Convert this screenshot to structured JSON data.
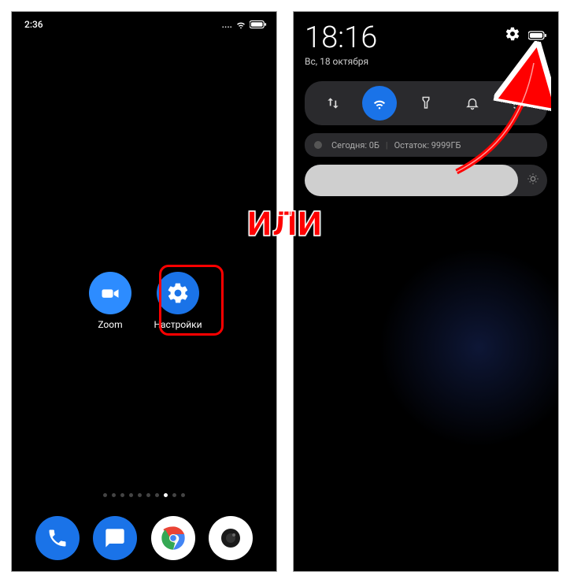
{
  "connector_label": "ИЛИ",
  "left": {
    "status_time": "2:36",
    "apps": {
      "zoom": {
        "label": "Zoom",
        "icon": "video-icon"
      },
      "settings": {
        "label": "Настройки",
        "icon": "gear-icon"
      }
    },
    "page_dots_total": 10,
    "page_dots_active_index": 7,
    "dock": [
      {
        "name": "phone",
        "icon": "phone-icon"
      },
      {
        "name": "messages",
        "icon": "chat-icon"
      },
      {
        "name": "chrome",
        "icon": "chrome-icon"
      },
      {
        "name": "camera",
        "icon": "camera-icon"
      }
    ]
  },
  "right": {
    "panel_time": "18:16",
    "panel_date": "Вс, 18 октября",
    "qs_tiles": [
      {
        "name": "mobile-data",
        "icon": "data-arrows-icon",
        "on": false
      },
      {
        "name": "wifi",
        "icon": "wifi-icon",
        "on": true
      },
      {
        "name": "flashlight",
        "icon": "flashlight-icon",
        "on": false
      },
      {
        "name": "sound",
        "icon": "bell-icon",
        "on": false
      },
      {
        "name": "screenshot",
        "icon": "screenshot-icon",
        "on": false
      }
    ],
    "data_usage": {
      "today_label": "Сегодня: 0Б",
      "remaining_label": "Остаток: 9999ГБ"
    },
    "brightness_percent": 88
  },
  "colors": {
    "accent_blue": "#1a73e8",
    "highlight_red": "#ff0000",
    "panel_tile": "#2a2a2d"
  }
}
